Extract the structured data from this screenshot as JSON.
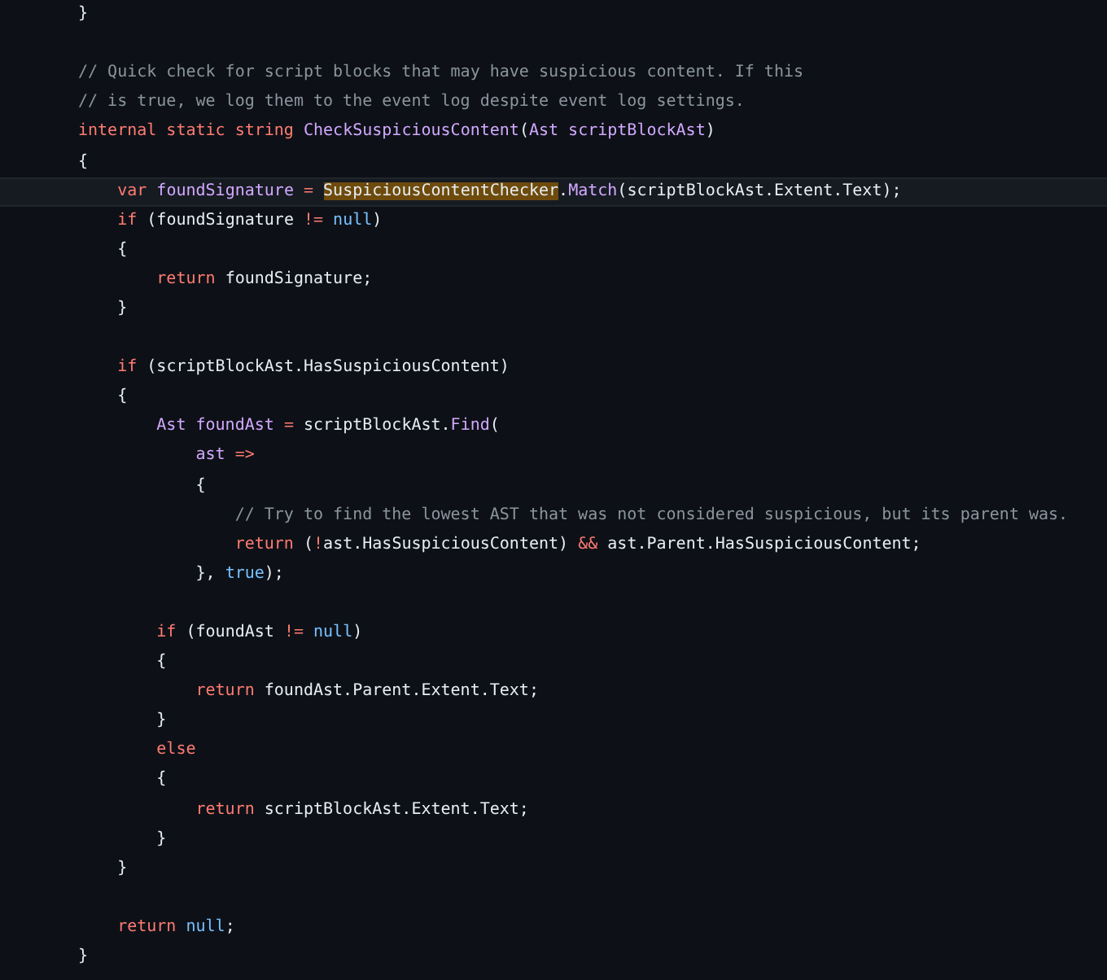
{
  "code": {
    "lines": [
      {
        "current": false,
        "tokens": [
          {
            "kind": "plain",
            "text": "}"
          }
        ]
      },
      {
        "current": false
      },
      {
        "current": false,
        "tokens": [
          {
            "kind": "comment",
            "text": "// Quick check for script blocks that may have suspicious content. If this"
          }
        ]
      },
      {
        "current": false,
        "tokens": [
          {
            "kind": "comment",
            "text": "// is true, we log them to the event log despite event log settings."
          }
        ]
      },
      {
        "current": false,
        "tokens": [
          {
            "kind": "keyword",
            "text": "internal static string "
          },
          {
            "kind": "name",
            "text": "CheckSuspiciousContent"
          },
          {
            "kind": "plain",
            "text": "("
          },
          {
            "kind": "name",
            "text": "Ast scriptBlockAst"
          },
          {
            "kind": "plain",
            "text": ")"
          }
        ]
      },
      {
        "current": false,
        "tokens": [
          {
            "kind": "plain",
            "text": "{"
          }
        ]
      },
      {
        "current": true,
        "tokens": [
          {
            "kind": "keyword",
            "text": "    var "
          },
          {
            "kind": "name",
            "text": "foundSignature "
          },
          {
            "kind": "operator",
            "text": "= "
          },
          {
            "kind": "match",
            "text": "SuspiciousContentChecker"
          },
          {
            "kind": "plain",
            "text": "."
          },
          {
            "kind": "name",
            "text": "Match"
          },
          {
            "kind": "plain",
            "text": "(scriptBlockAst.Extent.Text);"
          }
        ]
      },
      {
        "current": false,
        "tokens": [
          {
            "kind": "keyword",
            "text": "    if "
          },
          {
            "kind": "plain",
            "text": "(foundSignature "
          },
          {
            "kind": "operator",
            "text": "!= "
          },
          {
            "kind": "literal",
            "text": "null"
          },
          {
            "kind": "plain",
            "text": ")"
          }
        ]
      },
      {
        "current": false,
        "tokens": [
          {
            "kind": "plain",
            "text": "    {"
          }
        ]
      },
      {
        "current": false,
        "tokens": [
          {
            "kind": "keyword",
            "text": "        return "
          },
          {
            "kind": "plain",
            "text": "foundSignature;"
          }
        ]
      },
      {
        "current": false,
        "tokens": [
          {
            "kind": "plain",
            "text": "    }"
          }
        ]
      },
      {
        "current": false
      },
      {
        "current": false,
        "tokens": [
          {
            "kind": "keyword",
            "text": "    if "
          },
          {
            "kind": "plain",
            "text": "(scriptBlockAst.HasSuspiciousContent)"
          }
        ]
      },
      {
        "current": false,
        "tokens": [
          {
            "kind": "plain",
            "text": "    {"
          }
        ]
      },
      {
        "current": false,
        "tokens": [
          {
            "kind": "name",
            "text": "        Ast foundAst "
          },
          {
            "kind": "operator",
            "text": "= "
          },
          {
            "kind": "plain",
            "text": "scriptBlockAst."
          },
          {
            "kind": "name",
            "text": "Find"
          },
          {
            "kind": "plain",
            "text": "("
          }
        ]
      },
      {
        "current": false,
        "tokens": [
          {
            "kind": "name",
            "text": "            ast "
          },
          {
            "kind": "operator",
            "text": "=>"
          }
        ]
      },
      {
        "current": false,
        "tokens": [
          {
            "kind": "plain",
            "text": "            {"
          }
        ]
      },
      {
        "current": false,
        "tokens": [
          {
            "kind": "comment",
            "text": "                // Try to find the lowest AST that was not considered suspicious, but its parent was."
          }
        ]
      },
      {
        "current": false,
        "tokens": [
          {
            "kind": "keyword",
            "text": "                return "
          },
          {
            "kind": "plain",
            "text": "("
          },
          {
            "kind": "operator",
            "text": "!"
          },
          {
            "kind": "plain",
            "text": "ast.HasSuspiciousContent) "
          },
          {
            "kind": "operator",
            "text": "&& "
          },
          {
            "kind": "plain",
            "text": "ast.Parent.HasSuspiciousContent;"
          }
        ]
      },
      {
        "current": false,
        "tokens": [
          {
            "kind": "plain",
            "text": "            }, "
          },
          {
            "kind": "literal",
            "text": "true"
          },
          {
            "kind": "plain",
            "text": ");"
          }
        ]
      },
      {
        "current": false
      },
      {
        "current": false,
        "tokens": [
          {
            "kind": "keyword",
            "text": "        if "
          },
          {
            "kind": "plain",
            "text": "(foundAst "
          },
          {
            "kind": "operator",
            "text": "!= "
          },
          {
            "kind": "literal",
            "text": "null"
          },
          {
            "kind": "plain",
            "text": ")"
          }
        ]
      },
      {
        "current": false,
        "tokens": [
          {
            "kind": "plain",
            "text": "        {"
          }
        ]
      },
      {
        "current": false,
        "tokens": [
          {
            "kind": "keyword",
            "text": "            return "
          },
          {
            "kind": "plain",
            "text": "foundAst.Parent.Extent.Text;"
          }
        ]
      },
      {
        "current": false,
        "tokens": [
          {
            "kind": "plain",
            "text": "        }"
          }
        ]
      },
      {
        "current": false,
        "tokens": [
          {
            "kind": "keyword",
            "text": "        else"
          }
        ]
      },
      {
        "current": false,
        "tokens": [
          {
            "kind": "plain",
            "text": "        {"
          }
        ]
      },
      {
        "current": false,
        "tokens": [
          {
            "kind": "keyword",
            "text": "            return "
          },
          {
            "kind": "plain",
            "text": "scriptBlockAst.Extent.Text;"
          }
        ]
      },
      {
        "current": false,
        "tokens": [
          {
            "kind": "plain",
            "text": "        }"
          }
        ]
      },
      {
        "current": false,
        "tokens": [
          {
            "kind": "plain",
            "text": "    }"
          }
        ]
      },
      {
        "current": false
      },
      {
        "current": false,
        "tokens": [
          {
            "kind": "keyword",
            "text": "    return "
          },
          {
            "kind": "literal",
            "text": "null"
          },
          {
            "kind": "plain",
            "text": ";"
          }
        ]
      },
      {
        "current": false,
        "tokens": [
          {
            "kind": "plain",
            "text": "}"
          }
        ]
      }
    ]
  }
}
